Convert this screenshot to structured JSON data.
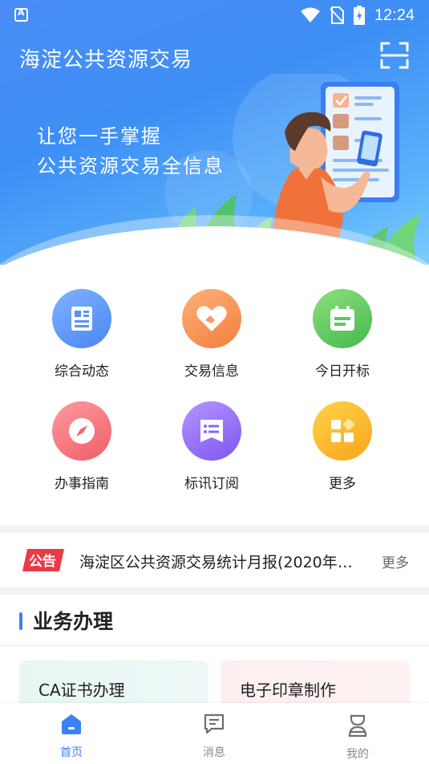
{
  "status_bar": {
    "time": "12:24",
    "icons": [
      "app-notification-icon",
      "wifi-icon",
      "no-sim-icon",
      "battery-charging-icon"
    ]
  },
  "header": {
    "title": "海淀公共资源交易",
    "scan_icon": "scan-icon"
  },
  "banner": {
    "slogan_line1": "让您一手掌握",
    "slogan_line2": "公共资源交易全信息"
  },
  "menu": [
    {
      "label": "综合动态",
      "icon": "news-document-icon",
      "color": "#4a86f3"
    },
    {
      "label": "交易信息",
      "icon": "heart-handshake-icon",
      "color": "#f37d3c"
    },
    {
      "label": "今日开标",
      "icon": "calendar-icon",
      "color": "#43b84d"
    },
    {
      "label": "办事指南",
      "icon": "compass-icon",
      "color": "#ee5e66"
    },
    {
      "label": "标讯订阅",
      "icon": "subscription-list-icon",
      "color": "#7d56ee"
    },
    {
      "label": "更多",
      "icon": "grid-more-icon",
      "color": "#f7a51d"
    }
  ],
  "notice": {
    "tag": "公告",
    "text": "海淀区公共资源交易统计月报(2020年…",
    "more": "更多"
  },
  "section": {
    "title": "业务办理",
    "cards": [
      {
        "title": "CA证书办理"
      },
      {
        "title": "电子印章制作"
      }
    ]
  },
  "tabbar": {
    "tabs": [
      {
        "label": "首页",
        "icon": "home-icon",
        "active": true
      },
      {
        "label": "消息",
        "icon": "message-icon",
        "active": false
      },
      {
        "label": "我的",
        "icon": "profile-icon",
        "active": false
      }
    ]
  },
  "colors": {
    "accent": "#3a82f5",
    "banner_gradient_start": "#4a8df7",
    "banner_gradient_end": "#7ccdfd",
    "notice_tag": "#e93b47"
  }
}
